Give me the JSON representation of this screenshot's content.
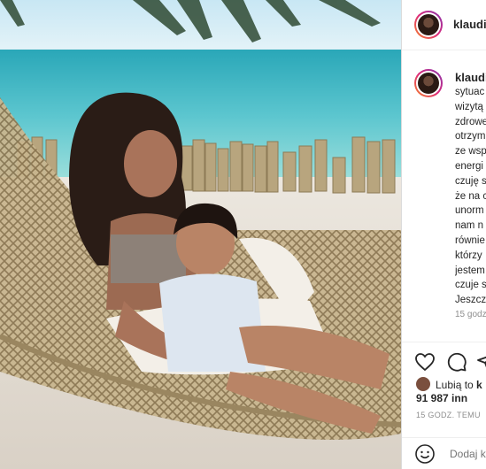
{
  "post": {
    "username": "klaudia",
    "caption_lines": [
      "sytuac",
      "wizytą",
      "zdrowe",
      "otrzym",
      "ze wsp",
      "energi",
      "czuję s",
      "że na c",
      "unorm",
      "nam n",
      "równie",
      "którzy",
      "jestem",
      "czuje s",
      "Jeszcz"
    ],
    "caption_time": "15 godz",
    "liked_by_prefix": "Lubią to",
    "liked_by_name": "k",
    "likes_count": "91 987 inn",
    "post_time": "15 GODZ. TEMU",
    "comment_placeholder": "Dodaj k"
  },
  "icons": {
    "like": "heart-icon",
    "comment": "comment-icon",
    "share": "share-icon",
    "emoji": "emoji-icon"
  },
  "colors": {
    "text": "#262626",
    "muted": "#8e8e8e",
    "border": "#dbdbdb",
    "story_ring": "#dd2a7b"
  }
}
